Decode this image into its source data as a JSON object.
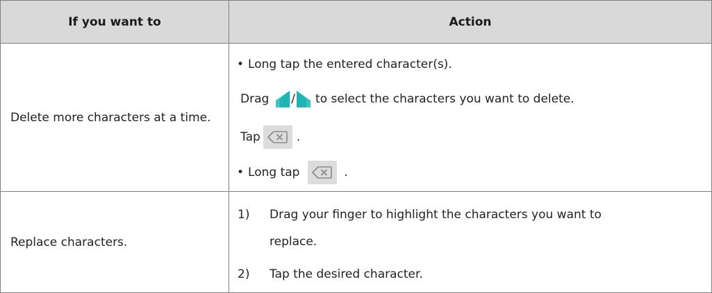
{
  "table": {
    "headers": [
      "If you want to",
      "Action"
    ],
    "rows": [
      {
        "task": "Delete more characters at a time.",
        "action": {
          "bullet": "•",
          "line1": "Long tap the entered character(s).",
          "drag_label": "Drag",
          "drag_slash": "/",
          "drag_text": "to select the characters you want to delete.",
          "tap_label": "Tap",
          "tap_period": ".",
          "long_tap_label": "Long tap",
          "long_tap_period": "."
        }
      },
      {
        "task": "Replace characters.",
        "steps": [
          {
            "num": "1)",
            "text": "Drag your finger to highlight the characters you want to",
            "cont": "replace."
          },
          {
            "num": "2)",
            "text": "Tap the desired character."
          }
        ]
      }
    ]
  },
  "colors": {
    "header_bg": "#d9d9d9",
    "handle_teal": "#1fb4b4",
    "key_bg": "#dcdcdc"
  },
  "icons": [
    "selection-handle-left-icon",
    "selection-handle-right-icon",
    "backspace-icon"
  ]
}
